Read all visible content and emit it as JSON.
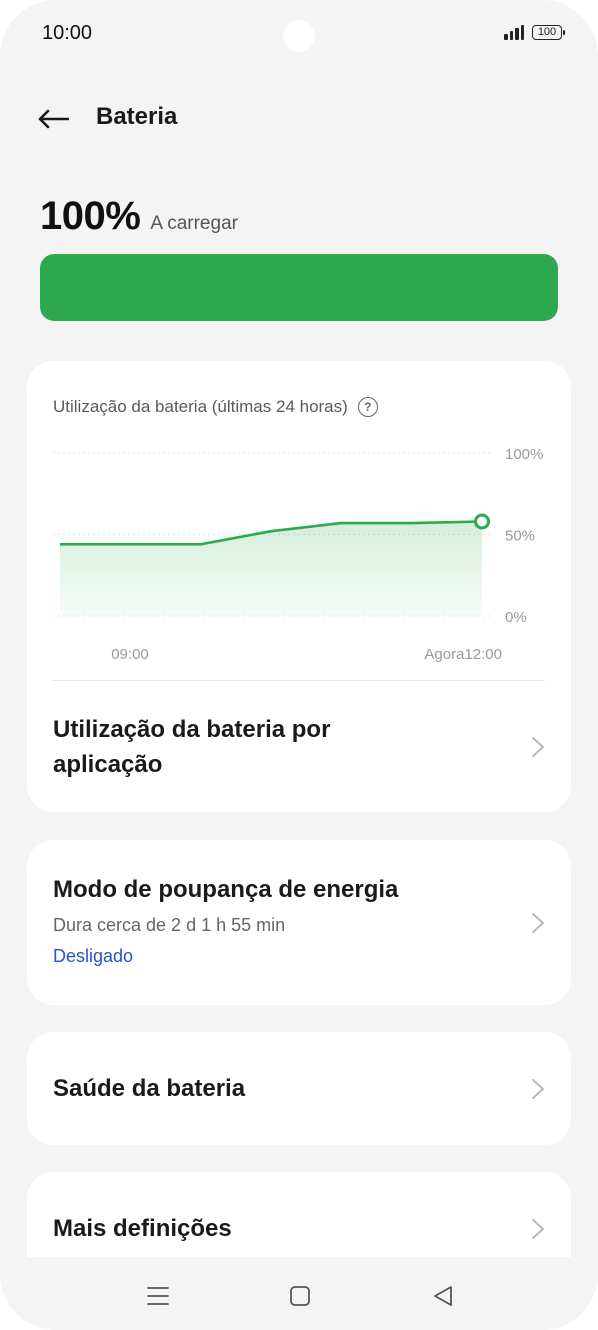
{
  "status_bar": {
    "time": "10:00",
    "battery_level": "100",
    "icons": [
      "signal-icon",
      "battery-icon"
    ]
  },
  "header": {
    "title": "Bateria",
    "back_icon": "arrow-left-icon"
  },
  "battery": {
    "percent": "100%",
    "status": "A carregar",
    "fill_fraction": 1.0,
    "fill_color": "#2ea94f"
  },
  "usage_card": {
    "title": "Utilização da bateria (últimas 24 horas)",
    "help_icon": "question-circle-icon",
    "chart_data": {
      "type": "area",
      "title": "",
      "y_ticks": [
        "100%",
        "50%",
        "0%"
      ],
      "x_ticks": [
        "09:00",
        "Agora12:00"
      ],
      "ylim": [
        0,
        100
      ],
      "grid": true,
      "series": [
        {
          "values": [
            44,
            44,
            44,
            52,
            57,
            57,
            58
          ]
        }
      ],
      "color": "#2ea94f"
    },
    "app_usage_label": "Utilização da bateria por aplicação"
  },
  "power_saving": {
    "title": "Modo de poupança de energia",
    "subtitle": "Dura cerca de 2 d 1 h 55 min",
    "status": "Desligado",
    "status_color": "#2d50c8"
  },
  "battery_health": {
    "title": "Saúde da bateria"
  },
  "more_settings": {
    "title": "Mais definições"
  },
  "nav_bar": {
    "icons": [
      "menu-icon",
      "home-icon",
      "back-triangle-icon"
    ]
  }
}
